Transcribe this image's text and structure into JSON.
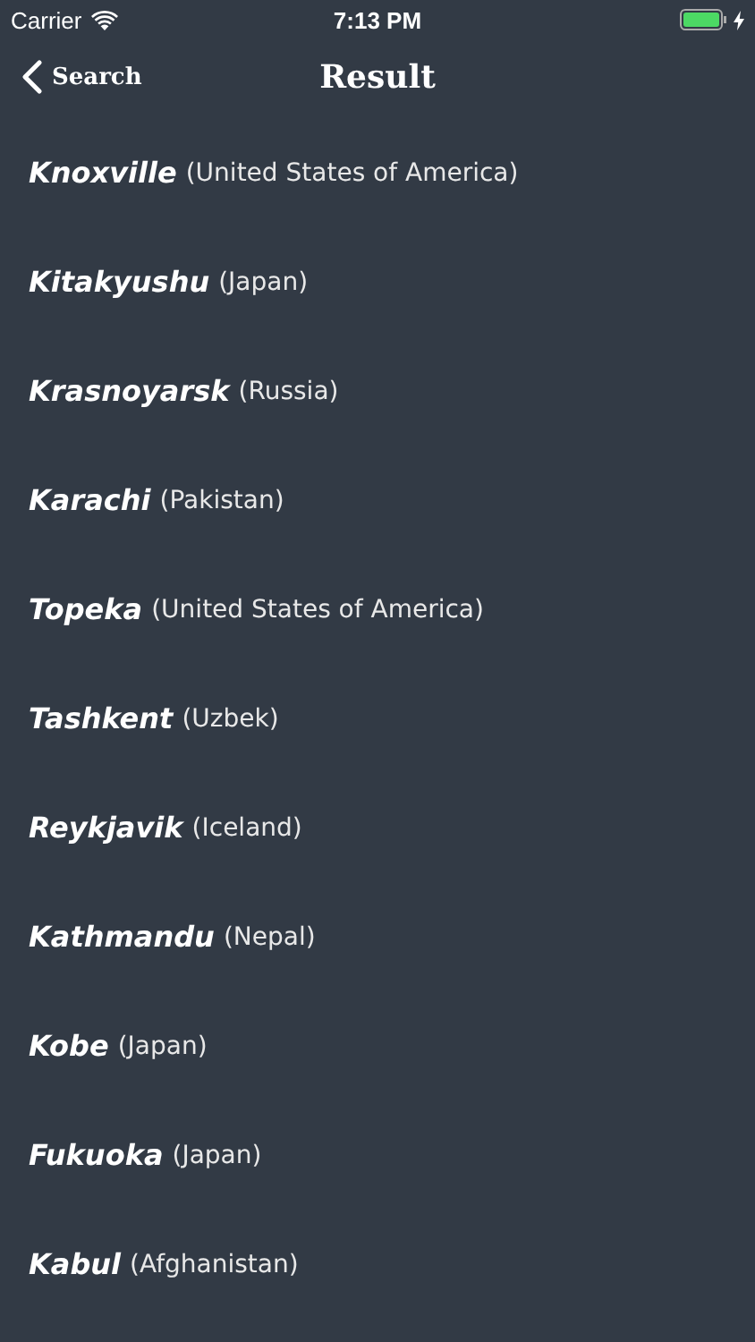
{
  "status_bar": {
    "carrier": "Carrier",
    "time": "7:13 PM"
  },
  "nav_bar": {
    "back_label": "Search",
    "title": "Result"
  },
  "results": [
    {
      "city": "Knoxville",
      "country": "(United States of America)"
    },
    {
      "city": "Kitakyushu",
      "country": "(Japan)"
    },
    {
      "city": "Krasnoyarsk",
      "country": "(Russia)"
    },
    {
      "city": "Karachi",
      "country": "(Pakistan)"
    },
    {
      "city": "Topeka",
      "country": "(United States of America)"
    },
    {
      "city": "Tashkent",
      "country": "(Uzbek)"
    },
    {
      "city": "Reykjavik",
      "country": "(Iceland)"
    },
    {
      "city": "Kathmandu",
      "country": "(Nepal)"
    },
    {
      "city": "Kobe",
      "country": "(Japan)"
    },
    {
      "city": "Fukuoka",
      "country": "(Japan)"
    },
    {
      "city": "Kabul",
      "country": "(Afghanistan)"
    }
  ]
}
